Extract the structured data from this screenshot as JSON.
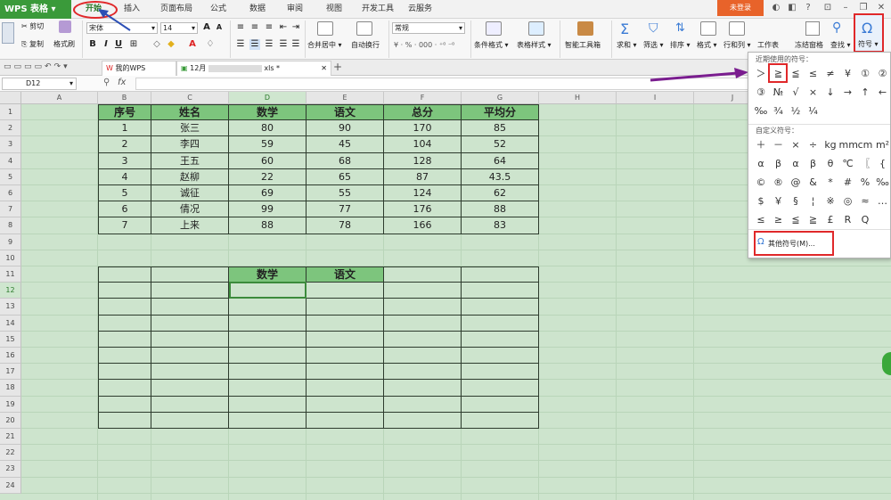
{
  "menubar": {
    "app_name": "WPS 表格",
    "items": [
      "开始",
      "插入",
      "页面布局",
      "公式",
      "数据",
      "审阅",
      "视图",
      "开发工具",
      "云服务"
    ],
    "login": "未登录"
  },
  "ribbon": {
    "cut": "剪切",
    "copy": "复制",
    "format_painter": "格式刷",
    "paste": "粘贴",
    "font_name": "宋体",
    "font_size": "14",
    "number_format": "常规",
    "merge_center": "合并居中",
    "wrap_text": "自动换行",
    "cond_format": "条件格式",
    "table_style": "表格样式",
    "smart_toolbox": "智能工具箱",
    "sum": "求和",
    "filter": "筛选",
    "sort": "排序",
    "format": "格式",
    "row_col": "行和列",
    "worksheet": "工作表",
    "freeze": "冻结窗格",
    "find": "查找",
    "symbol": "符号"
  },
  "tabs": {
    "my_wps": "我的WPS",
    "doc_prefix": "12月",
    "doc_suffix": "xls *",
    "add": "+"
  },
  "formulabar": {
    "cell_ref": "D12",
    "fx": "fx"
  },
  "grid": {
    "columns": [
      "A",
      "B",
      "C",
      "D",
      "E",
      "F",
      "G",
      "H",
      "I",
      "J"
    ],
    "rows": [
      "1",
      "2",
      "3",
      "4",
      "5",
      "6",
      "7",
      "8",
      "9",
      "10",
      "11",
      "12",
      "13",
      "14",
      "15",
      "16",
      "17",
      "18",
      "19",
      "20",
      "21",
      "22",
      "23",
      "24"
    ],
    "table1_header": [
      "序号",
      "姓名",
      "数学",
      "语文",
      "总分",
      "平均分"
    ],
    "table1_rows": [
      [
        "1",
        "张三",
        "80",
        "90",
        "170",
        "85"
      ],
      [
        "2",
        "李四",
        "59",
        "45",
        "104",
        "52"
      ],
      [
        "3",
        "王五",
        "60",
        "68",
        "128",
        "64"
      ],
      [
        "4",
        "赵柳",
        "22",
        "65",
        "87",
        "43.5"
      ],
      [
        "5",
        "诚征",
        "69",
        "55",
        "124",
        "62"
      ],
      [
        "6",
        "倩况",
        "99",
        "77",
        "176",
        "88"
      ],
      [
        "7",
        "上来",
        "88",
        "78",
        "166",
        "83"
      ]
    ],
    "table2_header": [
      "",
      "",
      "数学",
      "语文",
      "",
      ""
    ]
  },
  "symbol_panel": {
    "recent_title": "近期使用的符号：",
    "recent": [
      "＞",
      "≧",
      "≦",
      "≤",
      "≠",
      "¥",
      "①",
      "②",
      "③",
      "№",
      "√",
      "×",
      "↓",
      "→",
      "↑",
      "←",
      "‰",
      "¾",
      "½",
      "¼"
    ],
    "custom_title": "自定义符号：",
    "custom": [
      "＋",
      "－",
      "×",
      "÷",
      "kg",
      "mm",
      "cm",
      "m²",
      "α",
      "β",
      "α",
      "β",
      "θ",
      "℃",
      "〖",
      "{",
      "©",
      "®",
      "@",
      "&",
      "*",
      "#",
      "%",
      "‰",
      "$",
      "￥",
      "§",
      "¦",
      "※",
      "◎",
      "≈",
      "…",
      "≤",
      "≥",
      "≦",
      "≧",
      "£",
      "R",
      "Q",
      ""
    ],
    "more": "其他符号(M)..."
  },
  "colors": {
    "app_green": "#3a9a3a",
    "sheet_bg": "#cde4cd",
    "header_fill": "#7dc57d",
    "annotation_red": "#e0282a",
    "arrow_purple": "#7a1d8f",
    "arrow_blue": "#2c4fb5"
  }
}
